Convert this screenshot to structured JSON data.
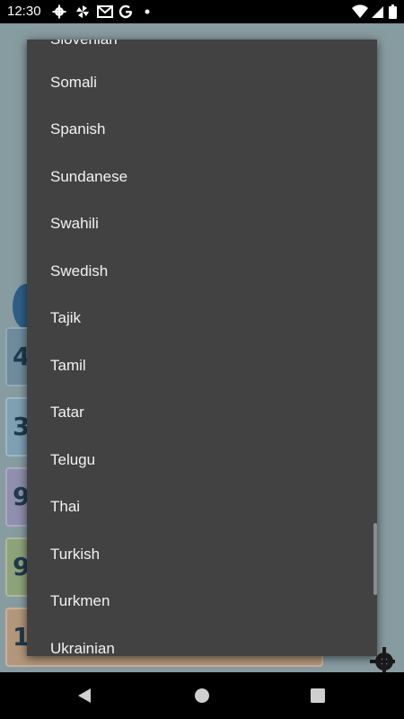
{
  "status_bar": {
    "time": "12:30",
    "left_icons": [
      "gear-icon",
      "pinwheel-icon",
      "gmail-icon",
      "google-icon",
      "dot-icon"
    ],
    "right_icons": [
      "wifi-icon",
      "signal-icon",
      "battery-icon"
    ]
  },
  "background": {
    "card_digits": [
      "4",
      "3",
      "9",
      "9",
      "1"
    ],
    "card_colors": [
      "#6f8c9c",
      "#7f9fb3",
      "#8f8fae",
      "#8fa37b",
      "#b3977b"
    ]
  },
  "dropdown": {
    "partial_top_item": "Slovenian",
    "items": [
      "Somali",
      "Spanish",
      "Sundanese",
      "Swahili",
      "Swedish",
      "Tajik",
      "Tamil",
      "Tatar",
      "Telugu",
      "Thai",
      "Turkish",
      "Turkmen",
      "Ukrainian"
    ]
  },
  "nav_bar": {
    "buttons": [
      "back-icon",
      "home-icon",
      "recents-icon"
    ]
  },
  "colors": {
    "popup_bg": "#424242",
    "popup_text": "#f2f2f2",
    "status_bg": "#000000"
  }
}
